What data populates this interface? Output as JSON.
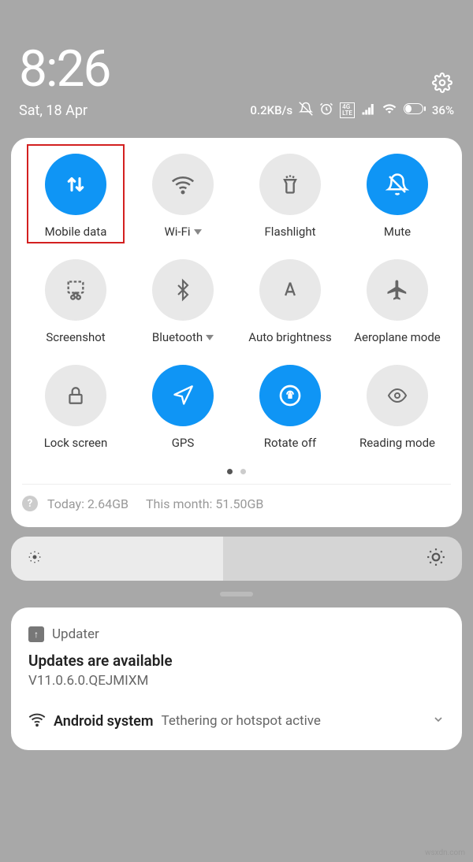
{
  "status": {
    "time": "8:26",
    "date": "Sat, 18 Apr",
    "speed": "0.2KB/s",
    "battery": "36%"
  },
  "tiles": {
    "mobile_data": "Mobile data",
    "wifi": "Wi-Fi",
    "flashlight": "Flashlight",
    "mute": "Mute",
    "screenshot": "Screenshot",
    "bluetooth": "Bluetooth",
    "auto_brightness": "Auto brightness",
    "aeroplane": "Aeroplane mode",
    "lock_screen": "Lock screen",
    "gps": "GPS",
    "rotate": "Rotate off",
    "reading": "Reading mode"
  },
  "data_usage": {
    "today": "Today: 2.64GB",
    "month": "This month: 51.50GB"
  },
  "notif1": {
    "app": "Updater",
    "title": "Updates are available",
    "subtitle": "V11.0.6.0.QEJMIXM"
  },
  "notif2": {
    "app": "Android system",
    "text": "Tethering or hotspot active"
  },
  "watermark": "wsxdn.com"
}
